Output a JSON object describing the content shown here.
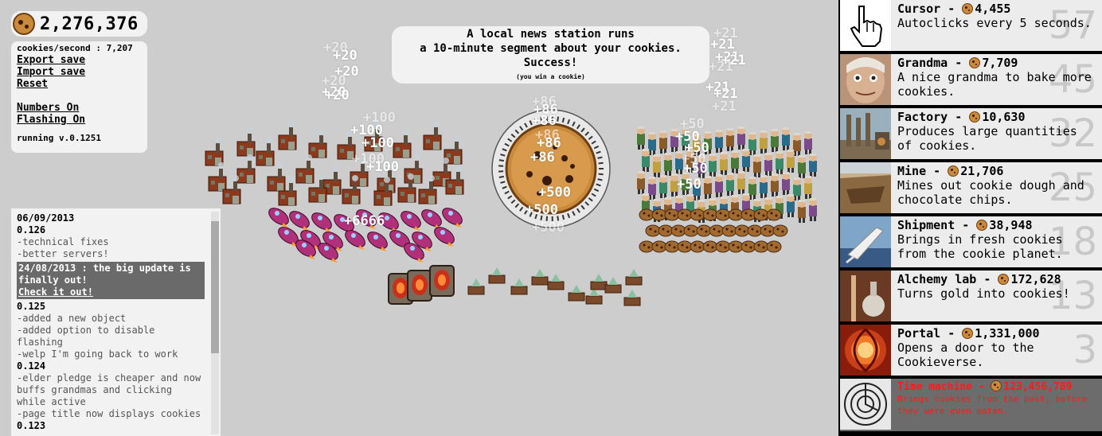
{
  "game": {
    "cookies": "2,276,376",
    "cookies_per_second_label": "cookies/second : 7,207",
    "menu": [
      "Export save",
      "Import save",
      "Reset"
    ],
    "toggles": [
      "Numbers On",
      "Flashing On"
    ],
    "version": "running v.0.1251"
  },
  "news": {
    "headline": "A local news station runs\na 10-minute segment about your cookies.\nSuccess!",
    "sub": "(you win a cookie)"
  },
  "changelog": {
    "entries": [
      {
        "kind": "date",
        "text": "06/09/2013"
      },
      {
        "kind": "ver",
        "text": "0.126"
      },
      {
        "kind": "item",
        "text": "-technical fixes"
      },
      {
        "kind": "item",
        "text": "-better servers!"
      },
      {
        "kind": "hl",
        "text": "24/08/2013 : the big update is finally out!",
        "link": "Check it out!"
      },
      {
        "kind": "ver",
        "text": "0.125"
      },
      {
        "kind": "item",
        "text": "-added a new object"
      },
      {
        "kind": "item",
        "text": "-added option to disable flashing"
      },
      {
        "kind": "item",
        "text": "-welp I'm going back to work"
      },
      {
        "kind": "ver",
        "text": "0.124"
      },
      {
        "kind": "item",
        "text": "-elder pledge is cheaper and now buffs grandmas and clicking while active"
      },
      {
        "kind": "item",
        "text": "-page title now displays cookies"
      },
      {
        "kind": "ver",
        "text": "0.123"
      }
    ]
  },
  "store": {
    "buildings": [
      {
        "name": "Cursor",
        "price": "4,455",
        "desc": "Autoclicks every 5 seconds.",
        "count": "57",
        "icon": "cursor-icon",
        "locked": false
      },
      {
        "name": "Grandma",
        "price": "7,709",
        "desc": "A nice grandma to bake more cookies.",
        "count": "45",
        "icon": "grandma-icon",
        "locked": false
      },
      {
        "name": "Factory",
        "price": "10,630",
        "desc": "Produces large quantities of cookies.",
        "count": "32",
        "icon": "factory-icon",
        "locked": false
      },
      {
        "name": "Mine",
        "price": "21,706",
        "desc": "Mines out cookie dough and chocolate chips.",
        "count": "25",
        "icon": "mine-icon",
        "locked": false
      },
      {
        "name": "Shipment",
        "price": "38,948",
        "desc": "Brings in fresh cookies from the cookie planet.",
        "count": "18",
        "icon": "shipment-icon",
        "locked": false
      },
      {
        "name": "Alchemy lab",
        "price": "172,628",
        "desc": "Turns gold into cookies!",
        "count": "13",
        "icon": "alchemy-lab-icon",
        "locked": false
      },
      {
        "name": "Portal",
        "price": "1,331,000",
        "desc": "Opens a door to the Cookieverse.",
        "count": "3",
        "icon": "portal-icon",
        "locked": false
      },
      {
        "name": "Time machine",
        "price": "123,456,789",
        "desc": "Brings cookies from the past, before they were even eaten.",
        "count": "",
        "icon": "time-machine-icon",
        "locked": true
      }
    ]
  },
  "floaters": {
    "cursor_gains": [
      "+20",
      "+20",
      "+20",
      "+20",
      "+20",
      "+20"
    ],
    "factory_gains": [
      "+100",
      "+100",
      "+100",
      "+100",
      "+100"
    ],
    "shipment_gain": "+6666",
    "cookie_gains": [
      "+86",
      "+86",
      "+86",
      "+86",
      "+86",
      "+86",
      "+500",
      "+500",
      "+500"
    ],
    "grandma_gains": [
      "+50",
      "+50",
      "+50",
      "+50",
      "+50",
      "+50"
    ],
    "right_gains": [
      "+21",
      "+21",
      "+21",
      "+21",
      "+21",
      "+21",
      "+21",
      "+21"
    ]
  },
  "colors": {
    "background": "#cdcdcd",
    "panel": "#f2f2f2",
    "store_row": "#ececec",
    "locked_row": "#6c6c6c",
    "locked_text": "#ff1a1a",
    "cookie": "#c98a3c"
  }
}
